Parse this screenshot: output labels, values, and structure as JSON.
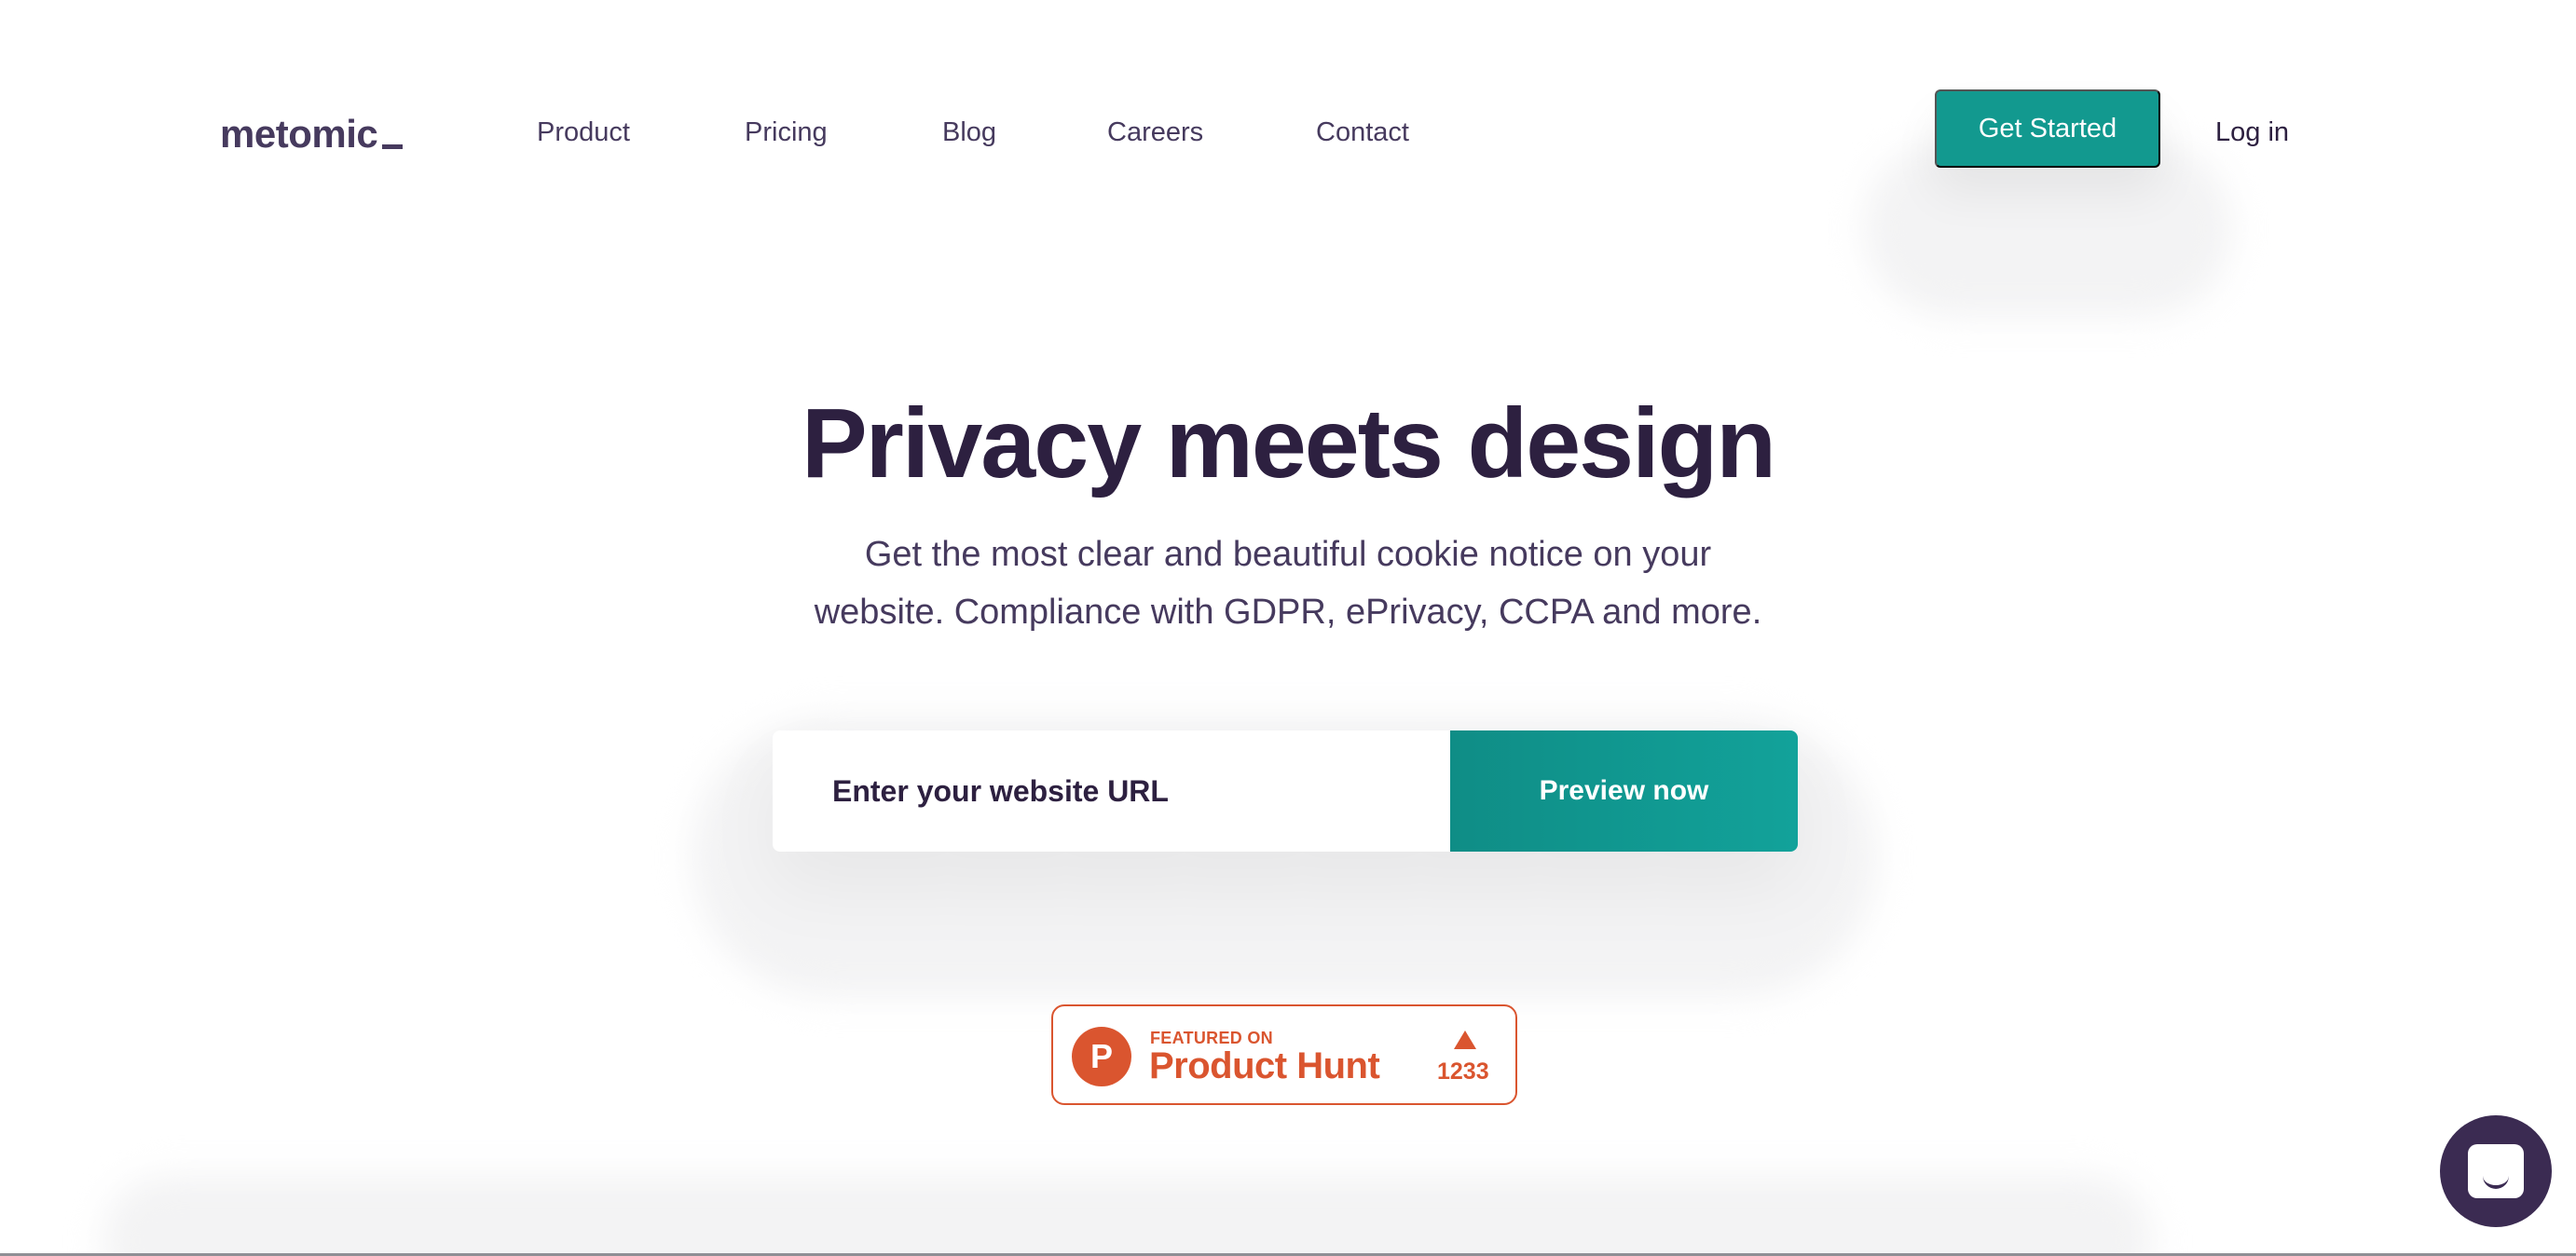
{
  "header": {
    "logo": "metomic",
    "nav": [
      "Product",
      "Pricing",
      "Blog",
      "Careers",
      "Contact"
    ],
    "get_started": "Get Started",
    "login": "Log in"
  },
  "hero": {
    "title": "Privacy meets design",
    "subtitle_line1": "Get the most clear and beautiful cookie notice on your",
    "subtitle_line2": "website. Compliance with GDPR, ePrivacy, CCPA and more.",
    "url_placeholder": "Enter your website URL",
    "preview_button": "Preview now"
  },
  "product_hunt": {
    "featured_on": "FEATURED ON",
    "name": "Product Hunt",
    "logo_letter": "P",
    "upvotes": "1233"
  },
  "icons": {
    "chat": "chat-icon",
    "product_hunt": "product-hunt-logo-icon",
    "upvote": "upvote-arrow-icon"
  },
  "colors": {
    "brand_teal": "#12998f",
    "brand_purple": "#2d2040",
    "product_hunt_orange": "#da552f",
    "chat_bg": "#3b2b52"
  }
}
